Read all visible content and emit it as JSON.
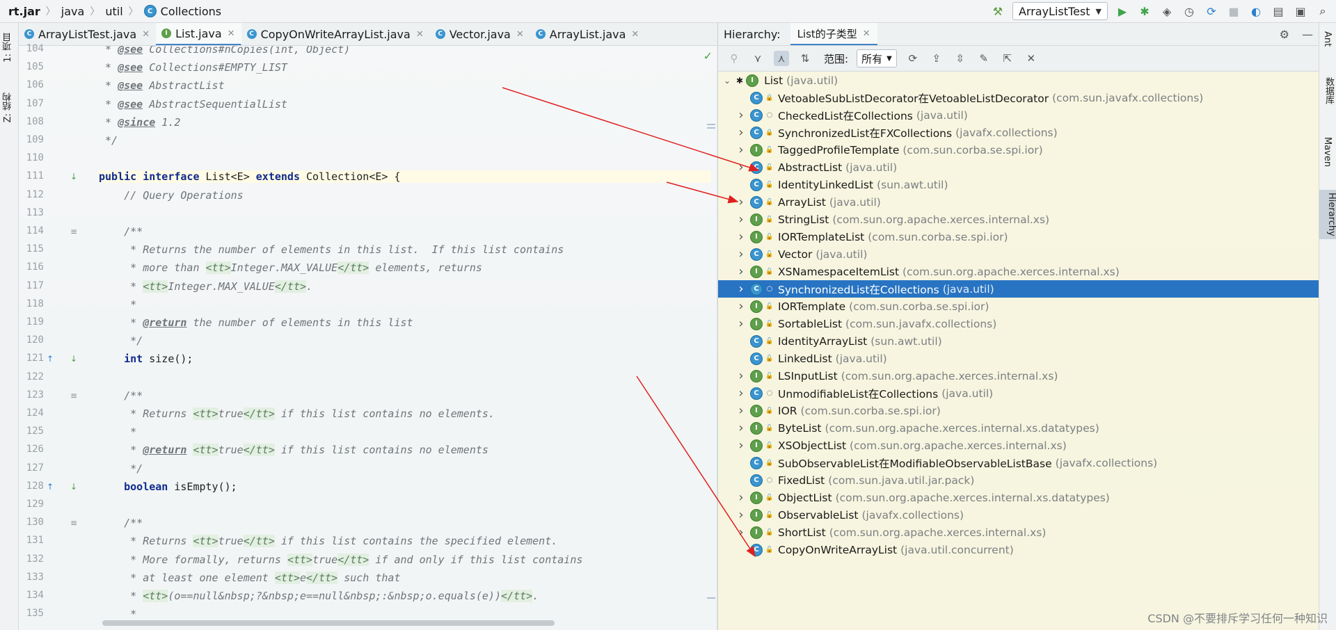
{
  "nav": {
    "crumbs": [
      "rt.jar",
      "java",
      "util",
      "Collections"
    ],
    "run_config": "ArrayListTest"
  },
  "left_strip": {
    "tabs": [
      "1: 项目",
      "Z: 结构"
    ]
  },
  "editor": {
    "tabs": [
      {
        "label": "ArrayListTest.java",
        "kind": "c"
      },
      {
        "label": "List.java",
        "kind": "i"
      },
      {
        "label": "CopyOnWriteArrayList.java",
        "kind": "c"
      },
      {
        "label": "Vector.java",
        "kind": "c"
      },
      {
        "label": "ArrayList.java",
        "kind": "c"
      }
    ],
    "active_tab": 1,
    "line_numbers": [
      "104",
      "105",
      "106",
      "107",
      "108",
      "109",
      "110",
      "111",
      "112",
      "113",
      "114",
      "115",
      "116",
      "117",
      "118",
      "119",
      "120",
      "121",
      "122",
      "123",
      "124",
      "125",
      "126",
      "127",
      "128",
      "129",
      "130",
      "131",
      "132",
      "133",
      "134",
      "135"
    ],
    "lines": [
      " * @see Collections#nCopies(int, Object)",
      " * @see Collections#EMPTY_LIST",
      " * @see AbstractList",
      " * @see AbstractSequentialList",
      " * @since 1.2",
      " */",
      "",
      "public interface List<E> extends Collection<E> {",
      "    // Query Operations",
      "",
      "    /**",
      "     * Returns the number of elements in this list.  If this list contains",
      "     * more than <tt>Integer.MAX_VALUE</tt> elements, returns",
      "     * <tt>Integer.MAX_VALUE</tt>.",
      "     *",
      "     * @return the number of elements in this list",
      "     */",
      "    int size();",
      "",
      "    /**",
      "     * Returns <tt>true</tt> if this list contains no elements.",
      "     *",
      "     * @return <tt>true</tt> if this list contains no elements",
      "     */",
      "    boolean isEmpty();",
      "",
      "    /**",
      "     * Returns <tt>true</tt> if this list contains the specified element.",
      "     * More formally, returns <tt>true</tt> if and only if this list contains",
      "     * at least one element <tt>e</tt> such that",
      "     * <tt>(o==null&nbsp;?&nbsp;e==null&nbsp;:&nbsp;o.equals(e))</tt>.",
      "     *"
    ]
  },
  "hierarchy": {
    "title": "Hierarchy:",
    "tab_label": "List的子类型",
    "scope_label": "范围:",
    "scope_value": "所有",
    "root": {
      "name": "List",
      "pkg": "(java.util)"
    },
    "items": [
      {
        "name": "VetoableSubListDecorator在VetoableListDecorator",
        "pkg": "(com.sun.javafx.collections)",
        "kind": "c",
        "vis": "lock",
        "expand": false
      },
      {
        "name": "CheckedList在Collections",
        "pkg": "(java.util)",
        "kind": "c",
        "vis": "pkg",
        "expand": true
      },
      {
        "name": "SynchronizedList在FXCollections",
        "pkg": "(javafx.collections)",
        "kind": "c",
        "vis": "lock",
        "expand": true
      },
      {
        "name": "TaggedProfileTemplate",
        "pkg": "(com.sun.corba.se.spi.ior)",
        "kind": "i",
        "vis": "pub",
        "expand": true
      },
      {
        "name": "AbstractList",
        "pkg": "(java.util)",
        "kind": "c",
        "vis": "pub",
        "expand": true
      },
      {
        "name": "IdentityLinkedList",
        "pkg": "(sun.awt.util)",
        "kind": "c",
        "vis": "pub",
        "expand": false
      },
      {
        "name": "ArrayList",
        "pkg": "(java.util)",
        "kind": "c",
        "vis": "pub",
        "expand": true
      },
      {
        "name": "StringList",
        "pkg": "(com.sun.org.apache.xerces.internal.xs)",
        "kind": "i",
        "vis": "pub",
        "expand": true
      },
      {
        "name": "IORTemplateList",
        "pkg": "(com.sun.corba.se.spi.ior)",
        "kind": "i",
        "vis": "pub",
        "expand": true
      },
      {
        "name": "Vector",
        "pkg": "(java.util)",
        "kind": "c",
        "vis": "pub",
        "expand": true
      },
      {
        "name": "XSNamespaceItemList",
        "pkg": "(com.sun.org.apache.xerces.internal.xs)",
        "kind": "i",
        "vis": "pub",
        "expand": true
      },
      {
        "name": "SynchronizedList在Collections",
        "pkg": "(java.util)",
        "kind": "c",
        "vis": "pkg",
        "expand": true,
        "selected": true
      },
      {
        "name": "IORTemplate",
        "pkg": "(com.sun.corba.se.spi.ior)",
        "kind": "i",
        "vis": "pub",
        "expand": true
      },
      {
        "name": "SortableList",
        "pkg": "(com.sun.javafx.collections)",
        "kind": "i",
        "vis": "pub",
        "expand": true
      },
      {
        "name": "IdentityArrayList",
        "pkg": "(sun.awt.util)",
        "kind": "c",
        "vis": "pub",
        "expand": false
      },
      {
        "name": "LinkedList",
        "pkg": "(java.util)",
        "kind": "c",
        "vis": "pub",
        "expand": false
      },
      {
        "name": "LSInputList",
        "pkg": "(com.sun.org.apache.xerces.internal.xs)",
        "kind": "i",
        "vis": "pub",
        "expand": true
      },
      {
        "name": "UnmodifiableList在Collections",
        "pkg": "(java.util)",
        "kind": "c",
        "vis": "pkg",
        "expand": true
      },
      {
        "name": "IOR",
        "pkg": "(com.sun.corba.se.spi.ior)",
        "kind": "i",
        "vis": "pub",
        "expand": true
      },
      {
        "name": "ByteList",
        "pkg": "(com.sun.org.apache.xerces.internal.xs.datatypes)",
        "kind": "i",
        "vis": "pub",
        "expand": true
      },
      {
        "name": "XSObjectList",
        "pkg": "(com.sun.org.apache.xerces.internal.xs)",
        "kind": "i",
        "vis": "pub",
        "expand": true
      },
      {
        "name": "SubObservableList在ModifiableObservableListBase",
        "pkg": "(javafx.collections)",
        "kind": "c",
        "vis": "lock",
        "expand": false
      },
      {
        "name": "FixedList",
        "pkg": "(com.sun.java.util.jar.pack)",
        "kind": "c",
        "vis": "pkg",
        "expand": false
      },
      {
        "name": "ObjectList",
        "pkg": "(com.sun.org.apache.xerces.internal.xs.datatypes)",
        "kind": "i",
        "vis": "pub",
        "expand": true
      },
      {
        "name": "ObservableList",
        "pkg": "(javafx.collections)",
        "kind": "i",
        "vis": "pub",
        "expand": true
      },
      {
        "name": "ShortList",
        "pkg": "(com.sun.org.apache.xerces.internal.xs)",
        "kind": "i",
        "vis": "pub",
        "expand": true
      },
      {
        "name": "CopyOnWriteArrayList",
        "pkg": "(java.util.concurrent)",
        "kind": "c",
        "vis": "pub",
        "expand": false
      }
    ]
  },
  "right_strip": {
    "tabs": [
      "Ant",
      "数据库",
      "Maven",
      "Hierarchy"
    ]
  },
  "watermark": "CSDN @不要排斥学习任何一种知识",
  "colors": {
    "selection": "#2874c2",
    "annotation_arrow": "#e02020",
    "class_icon": "#3a95d0",
    "interface_icon": "#5ea04b"
  }
}
